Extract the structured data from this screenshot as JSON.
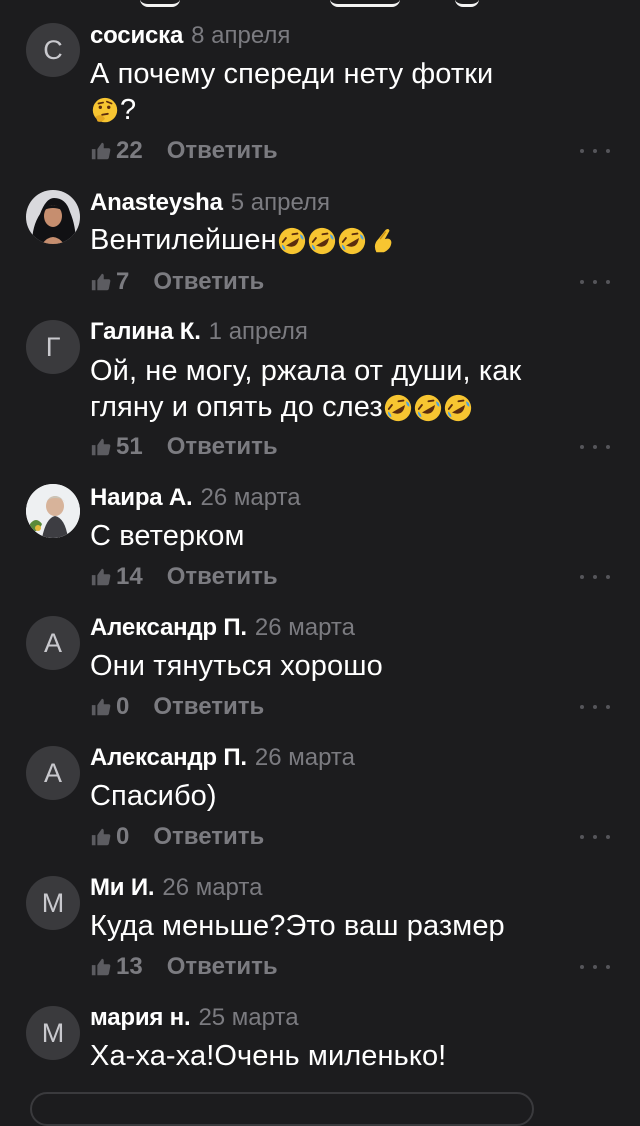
{
  "reply_label": "Ответить",
  "comments": [
    {
      "avatar_letter": "С",
      "author": "сосиска",
      "date": "8 апреля",
      "text_line1": "А почему спереди нету фотки",
      "text_line2": "?",
      "likes": "22",
      "emoji_icons": [
        "thinking-face-icon"
      ]
    },
    {
      "avatar_letter": "",
      "author": "Anasteysha",
      "date": "5 апреля",
      "text": "Вентилейшен",
      "likes": "7",
      "emoji_icons": [
        "rofl-icon",
        "rofl-icon",
        "rofl-icon",
        "pinching-hand-icon"
      ]
    },
    {
      "avatar_letter": "Г",
      "author": "Галина К.",
      "date": "1 апреля",
      "text_line1": "Ой, не могу, ржала от души, как",
      "text_line2": "гляну и опять до слез",
      "likes": "51",
      "emoji_icons": [
        "rofl-icon",
        "rofl-icon",
        "rofl-icon"
      ]
    },
    {
      "avatar_letter": "",
      "author": "Наира А.",
      "date": "26 марта",
      "text": "С ветерком",
      "likes": "14"
    },
    {
      "avatar_letter": "А",
      "author": "Александр П.",
      "date": "26 марта",
      "text": "Они тянуться хорошо",
      "likes": "0"
    },
    {
      "avatar_letter": "А",
      "author": "Александр П.",
      "date": "26 марта",
      "text": "Спасибо)",
      "likes": "0"
    },
    {
      "avatar_letter": "М",
      "author": "Ми И.",
      "date": "26 марта",
      "text": "Куда меньше?Это ваш размер",
      "likes": "13"
    },
    {
      "avatar_letter": "М",
      "author": "мария н.",
      "date": "25 марта",
      "text": "Ха-ха-ха!Очень миленько!",
      "likes": ""
    }
  ],
  "colors": {
    "background": "#1c1c1e",
    "avatar_bg": "#3a3a3d",
    "muted_text": "#7b7b80",
    "emoji_yellow": "#f7c531"
  }
}
